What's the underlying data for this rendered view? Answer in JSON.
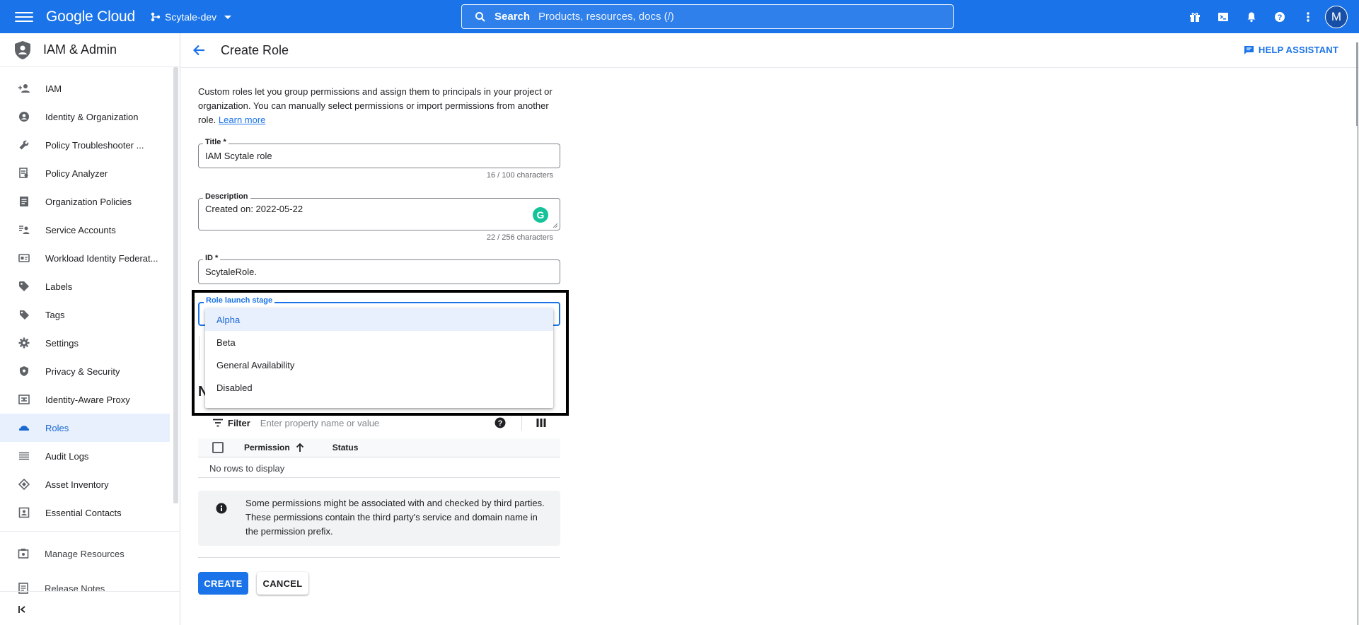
{
  "topbar": {
    "logo": "Google Cloud",
    "project": "Scytale-dev",
    "search_label": "Search",
    "search_placeholder": "Products, resources, docs (/)",
    "avatar_letter": "M"
  },
  "sidebar": {
    "title": "IAM & Admin",
    "items": [
      {
        "label": "IAM",
        "icon": "person-add-icon"
      },
      {
        "label": "Identity & Organization",
        "icon": "account-circle-icon"
      },
      {
        "label": "Policy Troubleshooter ...",
        "icon": "wrench-icon"
      },
      {
        "label": "Policy Analyzer",
        "icon": "policy-doc-icon"
      },
      {
        "label": "Organization Policies",
        "icon": "list-doc-icon"
      },
      {
        "label": "Service Accounts",
        "icon": "service-account-icon"
      },
      {
        "label": "Workload Identity Federat...",
        "icon": "id-card-icon"
      },
      {
        "label": "Labels",
        "icon": "label-icon"
      },
      {
        "label": "Tags",
        "icon": "tag-icon"
      },
      {
        "label": "Settings",
        "icon": "gear-icon"
      },
      {
        "label": "Privacy & Security",
        "icon": "shield-icon"
      },
      {
        "label": "Identity-Aware Proxy",
        "icon": "proxy-icon"
      },
      {
        "label": "Roles",
        "icon": "roles-hat-icon",
        "active": true
      },
      {
        "label": "Audit Logs",
        "icon": "lines-icon"
      },
      {
        "label": "Asset Inventory",
        "icon": "diamond-icon"
      },
      {
        "label": "Essential Contacts",
        "icon": "contacts-icon"
      }
    ],
    "manage_resources": "Manage Resources",
    "release_notes": "Release Notes"
  },
  "header": {
    "title": "Create Role",
    "help_assistant": "HELP ASSISTANT"
  },
  "form": {
    "intro": "Custom roles let you group permissions and assign them to principals in your project or organization. You can manually select permissions or import permissions from another role.",
    "learn_more": "Learn more",
    "title_label": "Title *",
    "title_value": "IAM Scytale role",
    "title_counter": "16 / 100 characters",
    "description_label": "Description",
    "description_value": "Created on: 2022-05-22",
    "description_counter": "22 / 256 characters",
    "id_label": "ID *",
    "id_value": "ScytaleRole.",
    "launch_stage_label": "Role launch stage",
    "launch_stage_options": [
      "Alpha",
      "Beta",
      "General Availability",
      "Disabled"
    ],
    "launch_stage_selected": "Alpha",
    "section_peek": "N"
  },
  "permissions": {
    "filter_label": "Filter",
    "filter_placeholder": "Enter property name or value",
    "col_permission": "Permission",
    "col_status": "Status",
    "empty": "No rows to display",
    "info": "Some permissions might be associated with and checked by third parties. These permissions contain the third party's service and domain name in the permission prefix."
  },
  "actions": {
    "create": "CREATE",
    "cancel": "CANCEL"
  },
  "colors": {
    "primary": "#1a73e8",
    "active_bg": "#e8f0fe"
  }
}
